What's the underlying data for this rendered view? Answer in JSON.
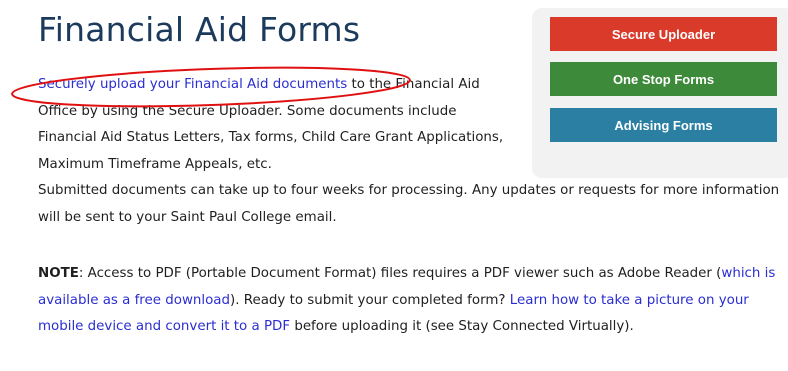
{
  "page": {
    "title": "Financial Aid Forms"
  },
  "intro": {
    "link_text": "Securely upload your Financial Aid documents",
    "text_1": " to the Financial Aid Office by using the Secure Uploader. Some documents include Financial Aid Status Letters, Tax forms, Child Care Grant Applications, Maximum Timeframe Appeals, etc.",
    "text_2": "Submitted documents can take up to four weeks for processing. Any updates or requests for more information will be sent to your Saint Paul College email."
  },
  "note": {
    "label": "NOTE",
    "text_1": ": Access to PDF (Portable Document Format) files requires a PDF viewer such as Adobe Reader (",
    "link_1": "which is available as a free download",
    "text_2": "). Ready to submit your completed form? ",
    "link_2": "Learn how to take a picture on your mobile device and convert it to a PDF",
    "text_3": " before uploading it (see Stay Connected Virtually)."
  },
  "buttons": {
    "secure_uploader": "Secure Uploader",
    "one_stop_forms": "One Stop Forms",
    "advising_forms": "Advising Forms"
  },
  "colors": {
    "title": "#1b3a5c",
    "link": "#2a2ed0",
    "button_red": "#d93a2a",
    "button_green": "#3e8a3b",
    "button_blue": "#2a7fa3",
    "annotation_oval": "#e01010"
  }
}
